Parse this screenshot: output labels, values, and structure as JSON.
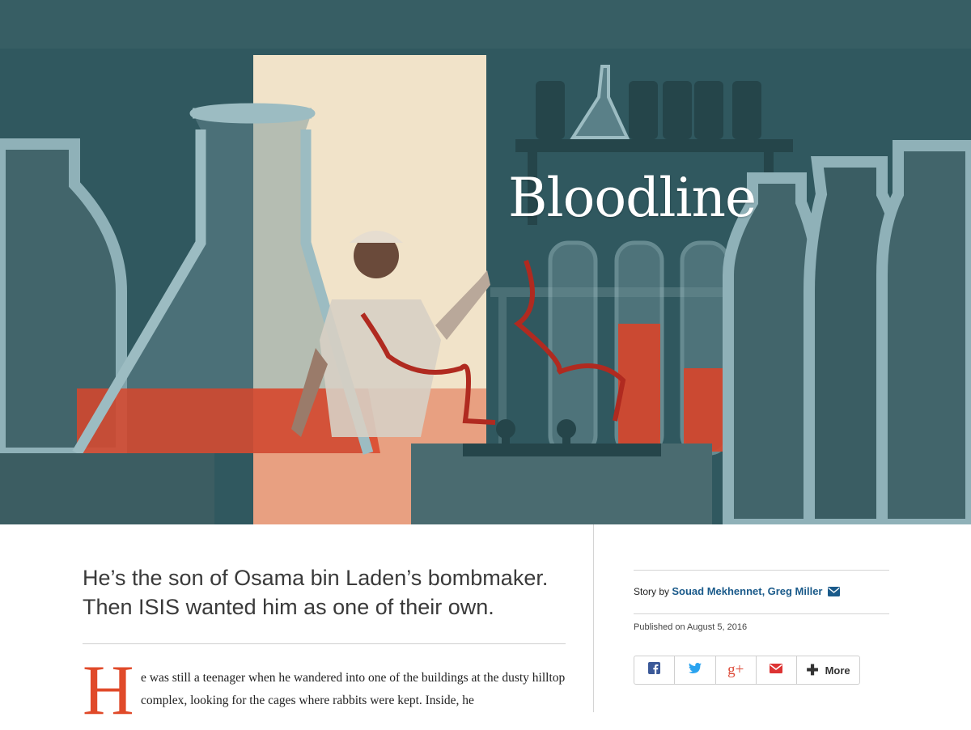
{
  "hero": {
    "title": "Bloodline",
    "illustration_icon": "laboratory-illustration",
    "colors": {
      "teal": "#30585f",
      "door": "#f1e3c9",
      "red": "#e0492a",
      "glass": "#8fb1b8"
    }
  },
  "article": {
    "dek": "He’s the son of Osama bin Laden’s bombmaker. Then ISIS wanted him as one of their own.",
    "dropcap": "H",
    "body_text": "e was still a teenager when he wandered into one of the buildings at the dusty hilltop complex, looking for the cages where rabbits were kept. Inside, he"
  },
  "sidebar": {
    "story_by_label": "Story by",
    "authors": [
      "Souad Mekhennet",
      "Greg Miller"
    ],
    "author_separator": ",",
    "email_icon": "envelope-icon",
    "published": "Published on August 5, 2016",
    "share": {
      "buttons": [
        {
          "icon": "facebook-icon",
          "color": "#3b5998"
        },
        {
          "icon": "twitter-icon",
          "color": "#2aa3ef"
        },
        {
          "icon": "google-plus-icon",
          "glyph": "g+",
          "color": "#dd4b39"
        },
        {
          "icon": "email-icon",
          "color": "#dd3333"
        }
      ],
      "more_label": "More"
    }
  }
}
